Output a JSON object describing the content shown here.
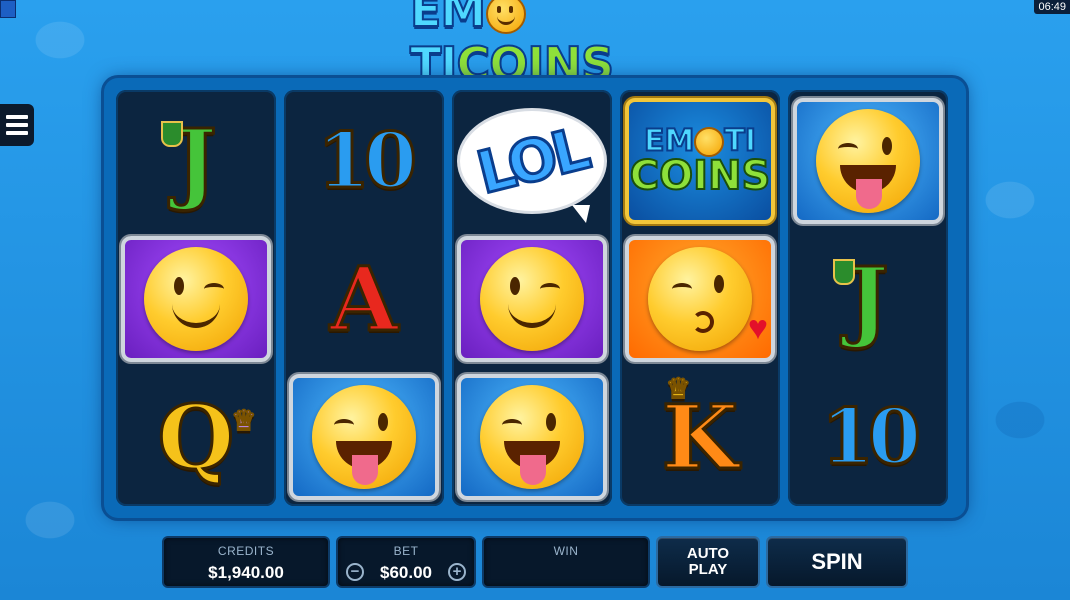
{
  "status": {
    "clock": "06:49"
  },
  "game": {
    "logo_left": "EM",
    "logo_mid": "TI",
    "logo_right": "COINS"
  },
  "reels": [
    [
      "J",
      "wink-purple",
      "Q"
    ],
    [
      "10",
      "A",
      "tongue-blue"
    ],
    [
      "LOL",
      "wink-purple",
      "tongue-blue"
    ],
    [
      "EMOTICOINS",
      "kiss-orange",
      "K"
    ],
    [
      "tongue-blue",
      "J",
      "10"
    ]
  ],
  "symbols": {
    "j": "J",
    "q": "Q",
    "a": "A",
    "k": "K",
    "ten": "10",
    "lol": "LOL",
    "wild_top": "EM",
    "wild_top2": "TI",
    "wild_bottom": "COINS"
  },
  "hud": {
    "credits_label": "CREDITS",
    "credits_value": "$1,940.00",
    "bet_label": "BET",
    "bet_value": "$60.00",
    "bet_minus": "−",
    "bet_plus": "+",
    "win_label": "WIN",
    "win_value": "",
    "autoplay_line1": "AUTO",
    "autoplay_line2": "PLAY",
    "spin_label": "SPIN"
  },
  "icons": [
    "menu-icon",
    "minus-icon",
    "plus-icon",
    "crown-icon",
    "shield-icon",
    "heart-icon"
  ],
  "colors": {
    "background": "#1f8fde",
    "panel": "#07182b",
    "accent_blue": "#39a6ff",
    "accent_green": "#8ee03a"
  }
}
